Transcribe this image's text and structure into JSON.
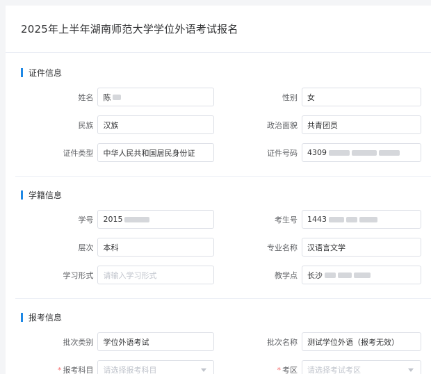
{
  "page": {
    "title": "2025年上半年湖南师范大学学位外语考试报名"
  },
  "sections": [
    {
      "title": "证件信息",
      "rows": [
        {
          "left": {
            "label": "姓名",
            "value": "陈"
          },
          "right": {
            "label": "性别",
            "value": "女"
          }
        },
        {
          "left": {
            "label": "民族",
            "value": "汉族"
          },
          "right": {
            "label": "政治面貌",
            "value": "共青团员"
          }
        },
        {
          "left": {
            "label": "证件类型",
            "value": "中华人民共和国居民身份证"
          },
          "right": {
            "label": "证件号码",
            "value": "4309"
          }
        }
      ]
    },
    {
      "title": "学籍信息",
      "rows": [
        {
          "left": {
            "label": "学号",
            "value": "2015"
          },
          "right": {
            "label": "考生号",
            "value": "1443"
          }
        },
        {
          "left": {
            "label": "层次",
            "value": "本科"
          },
          "right": {
            "label": "专业名称",
            "value": "汉语言文学"
          }
        },
        {
          "left": {
            "label": "学习形式",
            "placeholder": "请输入学习形式"
          },
          "right": {
            "label": "教学点",
            "value": "长沙"
          }
        }
      ]
    },
    {
      "title": "报考信息",
      "rows": [
        {
          "left": {
            "label": "批次类别",
            "value": "学位外语考试"
          },
          "right": {
            "label": "批次名称",
            "value": "测试学位外语（报考无效）"
          }
        },
        {
          "left": {
            "label": "报考科目",
            "required": "*",
            "placeholder": "请选择报考科目"
          },
          "right": {
            "label": "考区",
            "required": "*",
            "placeholder": "请选择考试考区"
          }
        }
      ]
    }
  ],
  "icons": {
    "select_caret": "chevron-down-icon"
  },
  "colors": {
    "accent": "#1e88e5",
    "required": "#f56c6c",
    "border": "#dcdfe6"
  }
}
